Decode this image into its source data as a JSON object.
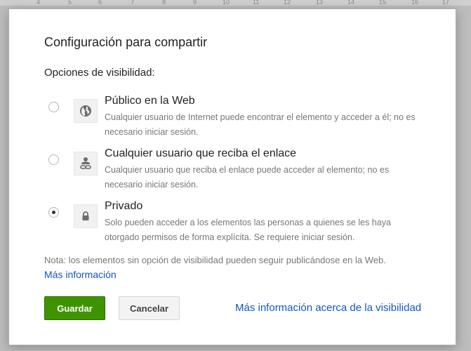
{
  "background": {
    "ruler_numbers": [
      "4",
      "5",
      "6",
      "7",
      "8",
      "9",
      "10",
      "11",
      "12",
      "13",
      "14",
      "15",
      "16",
      "17"
    ]
  },
  "dialog": {
    "title": "Configuración para compartir",
    "section_label": "Opciones de visibilidad:",
    "options": [
      {
        "title": "Público en la Web",
        "description": "Cualquier usuario de Internet puede encontrar el elemento y acceder a él; no es necesario iniciar sesión.",
        "icon": "globe-icon",
        "selected": false
      },
      {
        "title": "Cualquier usuario que reciba el enlace",
        "description": "Cualquier usuario que reciba el enlace puede acceder al elemento; no es necesario iniciar sesión.",
        "icon": "person-link-icon",
        "selected": false
      },
      {
        "title": "Privado",
        "description": "Solo pueden acceder a los elementos las personas a quienes se les haya otorgado permisos de forma explícita. Se requiere iniciar sesión.",
        "icon": "lock-icon",
        "selected": true
      }
    ],
    "note": "Nota: los elementos sin opción de visibilidad pueden seguir publicándose en la Web.",
    "more_info_link": "Más información",
    "save_label": "Guardar",
    "cancel_label": "Cancelar",
    "visibility_link": "Más información acerca de la visibilidad"
  },
  "colors": {
    "save_button": "#3d9400",
    "link": "#1155cc",
    "overlay": "#a8a8a8"
  }
}
